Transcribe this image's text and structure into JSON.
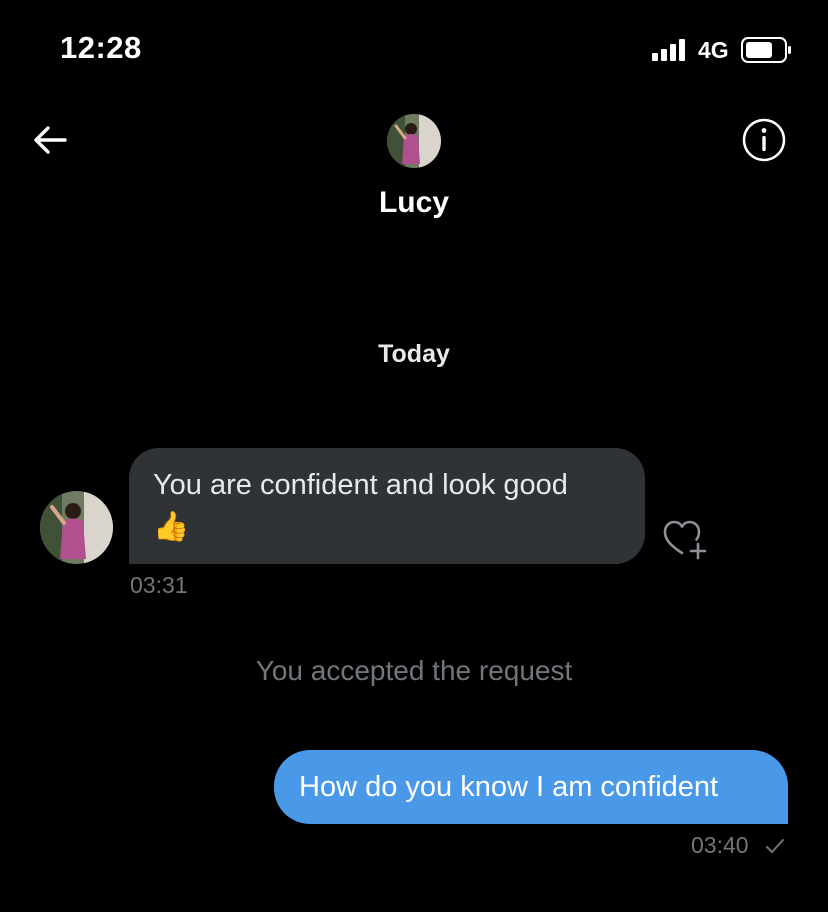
{
  "status_bar": {
    "time": "12:28",
    "network": "4G",
    "icons": [
      "signal-icon",
      "battery-icon"
    ]
  },
  "header": {
    "contact_name": "Lucy",
    "icons": [
      "back-arrow-icon",
      "info-icon"
    ]
  },
  "conversation": {
    "date_separator": "Today",
    "incoming": {
      "text": "You are confident and look good",
      "emoji": "👍",
      "timestamp": "03:31"
    },
    "system_note": "You accepted the request",
    "outgoing": {
      "text": "How do you know I am confident",
      "timestamp": "03:40"
    }
  },
  "colors": {
    "background": "#000000",
    "incoming_bubble": "#2f3336",
    "outgoing_bubble": "#4a99e9",
    "muted_text": "#71767b"
  }
}
